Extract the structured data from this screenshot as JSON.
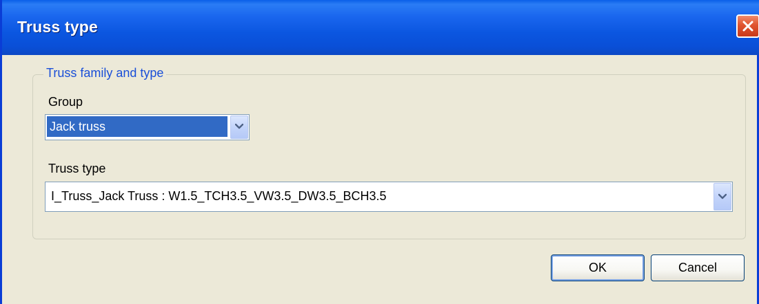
{
  "window": {
    "title": "Truss type"
  },
  "groupbox": {
    "legend": "Truss family and type"
  },
  "group": {
    "label": "Group",
    "selected": "Jack truss"
  },
  "truss_type": {
    "label": "Truss type",
    "selected": "I_Truss_Jack Truss : W1.5_TCH3.5_VW3.5_DW3.5_BCH3.5"
  },
  "buttons": {
    "ok": "OK",
    "cancel": "Cancel"
  },
  "icons": {
    "close": "close-icon",
    "dropdown": "chevron-down-icon"
  },
  "colors": {
    "titlebar": "#0b56e0",
    "legend_text": "#1a4fd8",
    "selection": "#316ac5",
    "close_button": "#e0542f"
  }
}
